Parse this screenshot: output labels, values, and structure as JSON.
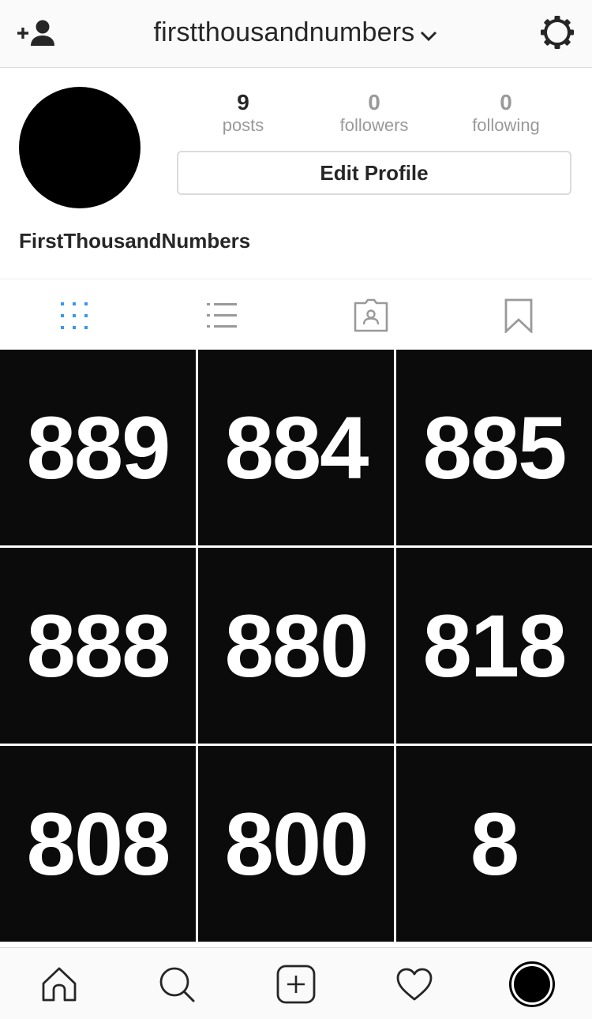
{
  "header": {
    "username": "firstthousandnumbers",
    "icons": {
      "left": "add-user-icon",
      "title_suffix": "chevron-down-icon",
      "right": "settings-gear-icon"
    }
  },
  "profile": {
    "stats": [
      {
        "value": "9",
        "label": "posts"
      },
      {
        "value": "0",
        "label": "followers"
      },
      {
        "value": "0",
        "label": "following"
      }
    ],
    "edit_button_label": "Edit Profile",
    "display_name": "FirstThousandNumbers"
  },
  "tabs": [
    {
      "name": "grid-view",
      "icon": "grid-icon",
      "active": true
    },
    {
      "name": "list-view",
      "icon": "list-icon",
      "active": false
    },
    {
      "name": "tagged",
      "icon": "tagged-photos-icon",
      "active": false
    },
    {
      "name": "saved",
      "icon": "bookmark-icon",
      "active": false
    }
  ],
  "posts": [
    "889",
    "884",
    "885",
    "888",
    "880",
    "818",
    "808",
    "800",
    "8"
  ],
  "bottom_nav": [
    {
      "name": "home",
      "icon": "home-icon"
    },
    {
      "name": "search",
      "icon": "search-icon"
    },
    {
      "name": "new-post",
      "icon": "add-post-icon"
    },
    {
      "name": "activity",
      "icon": "heart-icon"
    },
    {
      "name": "profile",
      "icon": "avatar"
    }
  ],
  "colors": {
    "active_tab": "#3897f0",
    "inactive_icon": "#999999",
    "tile_background": "#0b0b0b",
    "text_primary": "#262626",
    "text_secondary": "#999999",
    "border": "#dbdbdb"
  }
}
